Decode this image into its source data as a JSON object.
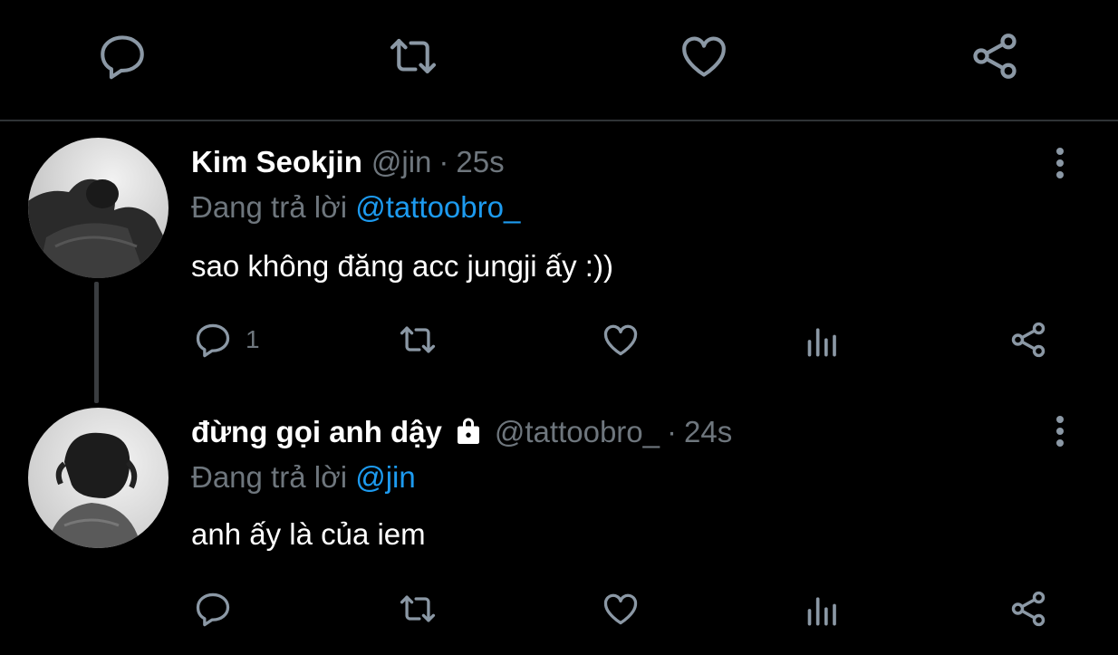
{
  "top_actions": {
    "icons": [
      "reply-icon",
      "retweet-icon",
      "like-icon",
      "share-icon"
    ]
  },
  "tweets": [
    {
      "author": "Kim Seokjin",
      "handle": "@jin",
      "dot": "·",
      "time": "25s",
      "reply_prefix": "Đang trả lời",
      "reply_mention": "@tattoobro_",
      "text": "sao không đăng acc jungji ấy :))",
      "reply_count": "1",
      "locked": false
    },
    {
      "author": "đừng gọi anh dậy",
      "handle": "@tattoobro_",
      "dot": "·",
      "time": "24s",
      "reply_prefix": "Đang trả lời",
      "reply_mention": "@jin",
      "text": "anh ấy là của iem",
      "reply_count": "",
      "locked": true
    }
  ],
  "colors": {
    "background": "#000000",
    "secondary_text": "#6e767d",
    "mention": "#1d9bf0",
    "divider": "#2f3336"
  }
}
